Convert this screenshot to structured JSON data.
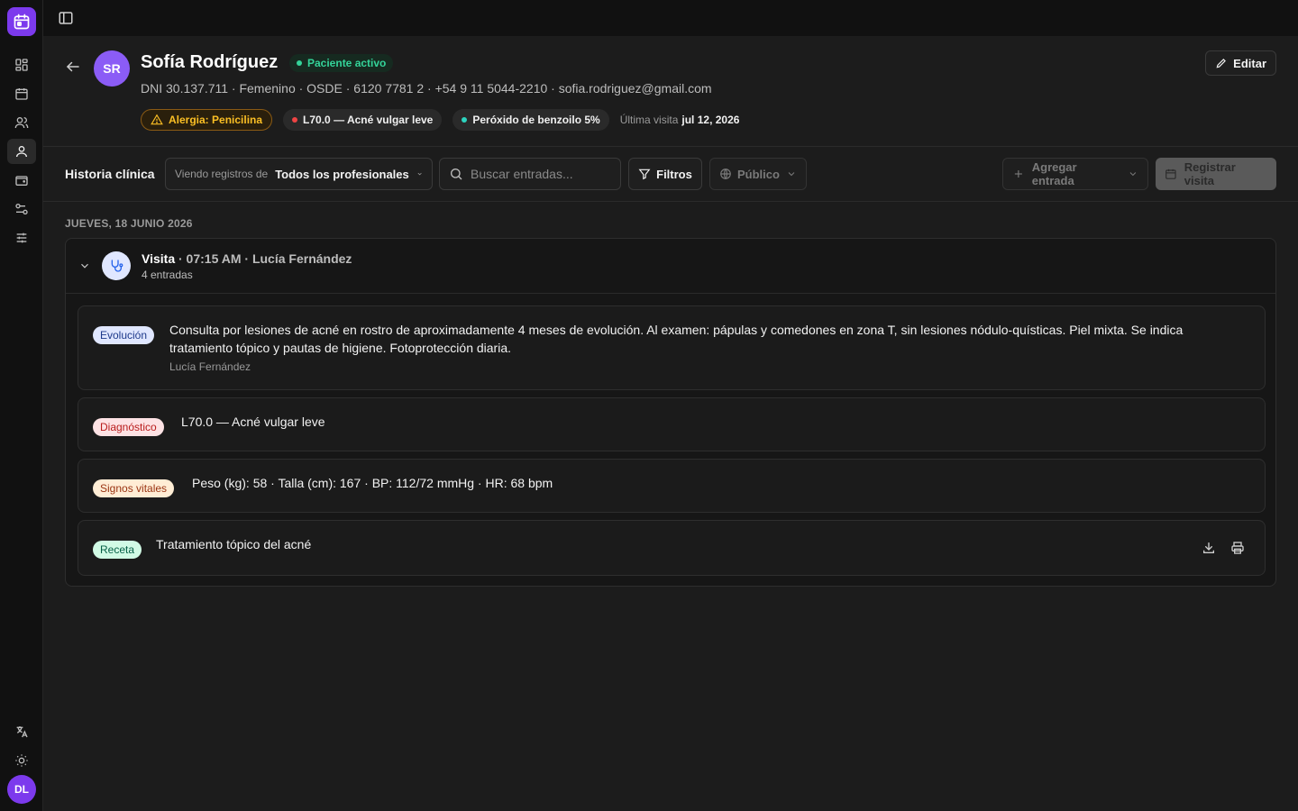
{
  "patient": {
    "initials": "SR",
    "name": "Sofía Rodríguez",
    "status": "Paciente activo",
    "meta": "DNI 30.137.711 · Femenino · OSDE · 6120 7781 2 · +54 9 11 5044-2210 · sofia.rodriguez@gmail.com",
    "allergy": "Alergia: Penicilina",
    "diagnosis_chip": "L70.0 — Acné vulgar leve",
    "medication_chip": "Peróxido de benzoilo 5%",
    "last_visit_label": "Última visita",
    "last_visit_value": "jul 12, 2026",
    "edit_label": "Editar"
  },
  "user": {
    "initials": "DL"
  },
  "toolbar": {
    "title": "Historia clínica",
    "viewing_label": "Viendo registros de",
    "viewing_value": "Todos los profesionales",
    "search_placeholder": "Buscar entradas...",
    "filters_label": "Filtros",
    "visibility_label": "Público",
    "add_entry_label": "Agregar entrada",
    "register_label": "Registrar visita"
  },
  "timeline": {
    "date_heading": "JUEVES, 18 JUNIO 2026",
    "visit": {
      "type": "Visita",
      "time": "· 07:15 AM",
      "professional": "· Lucía Fernández",
      "count": "4 entradas"
    },
    "entries": [
      {
        "badge": "Evolución",
        "text": "Consulta por lesiones de acné en rostro de aproximadamente 4 meses de evolución. Al examen: pápulas y comedones en zona T, sin lesiones nódulo-quísticas. Piel mixta. Se indica tratamiento tópico y pautas de higiene. Fotoprotección diaria.",
        "author": "Lucía Fernández"
      },
      {
        "badge": "Diagnóstico",
        "text": "L70.0 — Acné vulgar leve"
      },
      {
        "badge": "Signos vitales",
        "text": "Peso (kg): 58 · Talla (cm): 167 · BP: 112/72 mmHg · HR: 68 bpm"
      },
      {
        "badge": "Receta",
        "text": "Tratamiento tópico del acné"
      }
    ]
  },
  "colors": {
    "accent": "#7c3aed",
    "status_green": "#34d399",
    "allergy_amber": "#fbbf24",
    "diagnosis_red": "#ef4444",
    "medication_teal": "#2dd4bf"
  }
}
